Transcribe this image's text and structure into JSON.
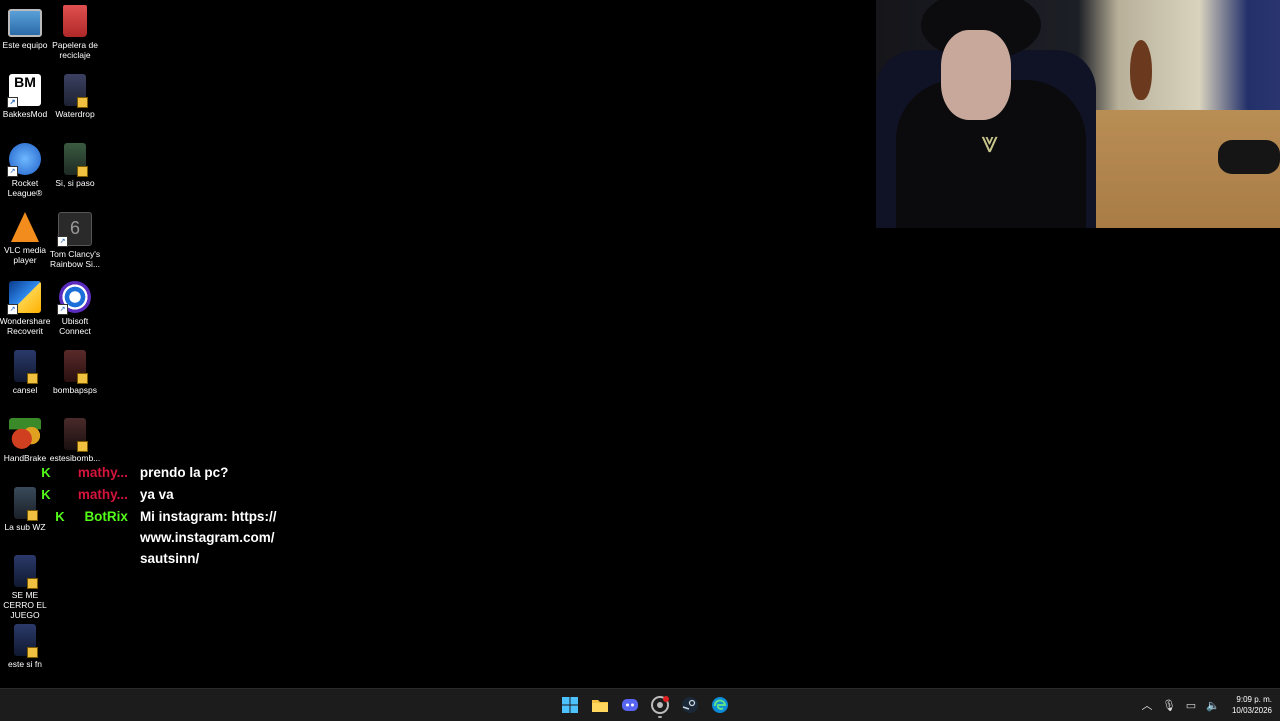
{
  "desktop": {
    "icons": [
      {
        "label": "Este equipo"
      },
      {
        "label": "Papelera de reciclaje"
      },
      {
        "label": "BakkesMod"
      },
      {
        "label": "Waterdrop"
      },
      {
        "label": "Rocket League®"
      },
      {
        "label": "Si, si paso"
      },
      {
        "label": "VLC media player"
      },
      {
        "label": "Tom Clancy's Rainbow Si..."
      },
      {
        "label": "Wondershare Recoverit"
      },
      {
        "label": "Ubisoft Connect"
      },
      {
        "label": "cansel"
      },
      {
        "label": "bombapsps"
      },
      {
        "label": "HandBrake"
      },
      {
        "label": "estesibomb..."
      },
      {
        "label": "La sub WZ"
      },
      {
        "label": "SE ME CERRO EL JUEGO"
      },
      {
        "label": "este si fn"
      }
    ]
  },
  "chat": {
    "messages": [
      {
        "badge": "K",
        "user": "mathy...",
        "text": "prendo la pc?"
      },
      {
        "badge": "K",
        "user": "mathy...",
        "text": "ya va"
      },
      {
        "badge": "K",
        "user": "BotRix",
        "text": "Mi instagram: https://www.instagram.com/sautsinn/"
      }
    ],
    "colors": {
      "mathy": "#d4143c",
      "botrix": "#53fc18"
    }
  },
  "taskbar": {
    "apps": [
      "start-icon",
      "file-explorer-icon",
      "discord-icon",
      "chrome-icon",
      "steam-icon",
      "edge-icon"
    ],
    "clock": {
      "time": "9:09 p. m.",
      "date": "10/03/2026"
    }
  }
}
